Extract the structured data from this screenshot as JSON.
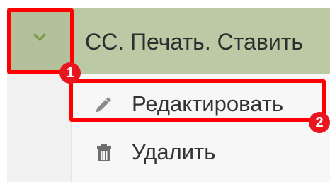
{
  "header": {
    "title": "СС. Печать. Ставить",
    "toggle_icon": "chevron-down-icon"
  },
  "menu": {
    "items": [
      {
        "label": "Редактировать",
        "icon": "pencil-icon"
      },
      {
        "label": "Удалить",
        "icon": "trash-icon"
      }
    ]
  },
  "annotations": {
    "marker_1": "1",
    "marker_2": "2"
  },
  "colors": {
    "header_bg": "#bcc9a5",
    "highlight": "#ff0000",
    "marker": "#e8161e"
  }
}
